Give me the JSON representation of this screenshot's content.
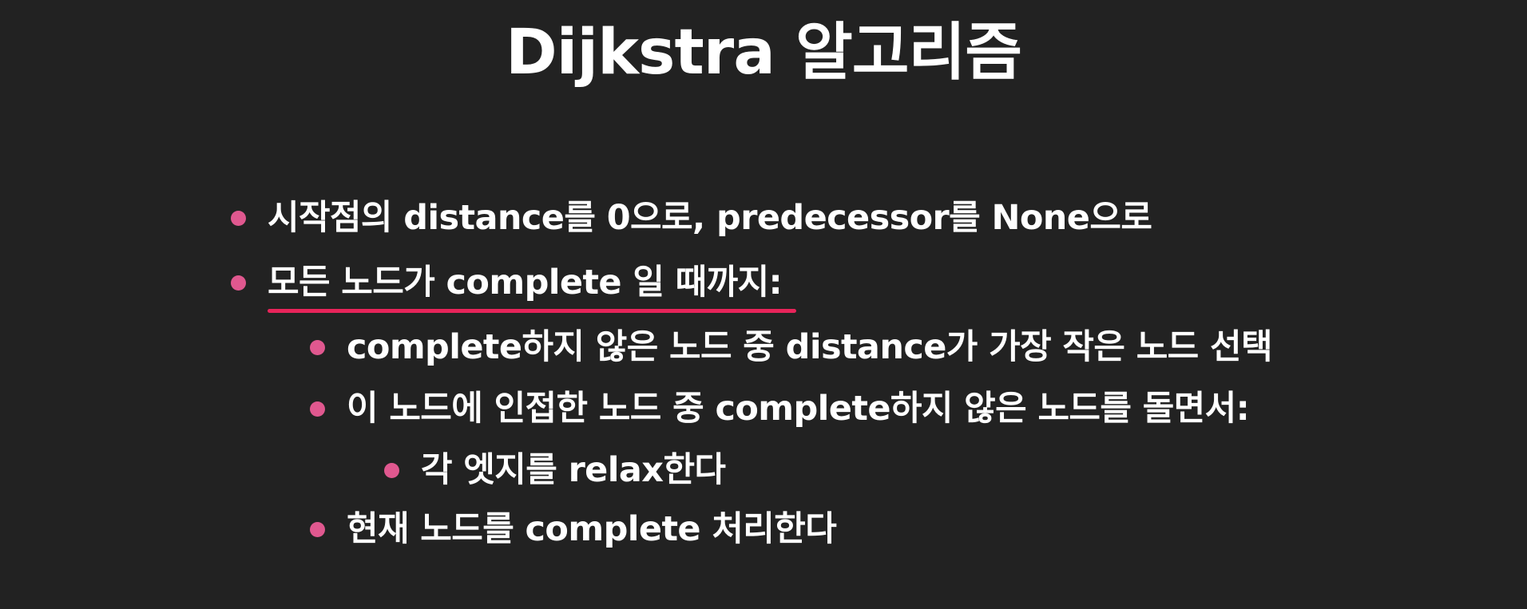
{
  "slide": {
    "title": "Dijkstra 알고리즘",
    "bullet_color": "#e0588f",
    "underline_color": "#e8245a",
    "bullets": [
      {
        "text": "시작점의 distance를 0으로, predecessor를 None으로",
        "level": 1
      },
      {
        "text": "모든 노드가 complete 일 때까지:",
        "level": 1,
        "underlined": true
      },
      {
        "text": "complete하지 않은 노드 중 distance가 가장 작은 노드 선택",
        "level": 2
      },
      {
        "text": "이 노드에 인접한 노드 중 complete하지 않은 노드를 돌면서:",
        "level": 2
      },
      {
        "text": "각 엣지를 relax한다",
        "level": 3
      },
      {
        "text": "현재 노드를 complete 처리한다",
        "level": 2
      }
    ]
  }
}
